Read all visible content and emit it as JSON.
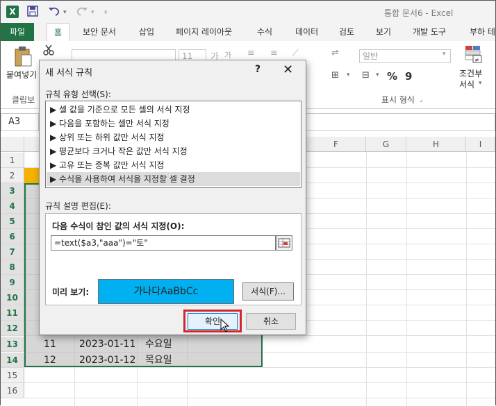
{
  "app": {
    "title": "통합 문서6 - Excel",
    "logo": "X"
  },
  "quick_access": {
    "icons": [
      "save-icon",
      "undo-icon",
      "redo-icon",
      "customize-icon"
    ]
  },
  "tabs": [
    "파일",
    "홈",
    "보안 문서",
    "삽입",
    "페이지 레이아웃",
    "수식",
    "데이터",
    "검토",
    "보기",
    "개발 도구",
    "부하 테"
  ],
  "ribbon": {
    "paste_label": "붙여넣기",
    "clipboard_label": "클립보",
    "font_size": "11",
    "number_format": "일반",
    "percent": "%",
    "comma": "9",
    "number_group_label": "표시 형식",
    "cond_format_line1": "조건부",
    "cond_format_line2": "서식 ",
    "cut_icon": "scissors-icon"
  },
  "namebox": "A3",
  "columns": [
    "F",
    "G",
    "H",
    "I"
  ],
  "rows": [
    "1",
    "2",
    "3",
    "4",
    "5",
    "6",
    "7",
    "8",
    "9",
    "10",
    "11",
    "12",
    "13",
    "14",
    "15",
    "16"
  ],
  "cells": [
    {
      "row": "13",
      "num": "11",
      "date": "2023-01-11",
      "day": "수요일"
    },
    {
      "row": "14",
      "num": "12",
      "date": "2023-01-12",
      "day": "목요일"
    }
  ],
  "dialog": {
    "title": "새 서식 규칙",
    "help": "?",
    "close": "✕",
    "rule_type_label": "규칙 유형 선택(S):",
    "rule_types": [
      "▶ 셀 값을 기준으로 모든 셀의 서식 지정",
      "▶ 다음을 포함하는 셀만 서식 지정",
      "▶ 상위 또는 하위 값만 서식 지정",
      "▶ 평균보다 크거나 작은 값만 서식 지정",
      "▶ 고유 또는 중복 값만 서식 지정",
      "▶ 수식을 사용하여 서식을 지정할 셀 결정"
    ],
    "desc_label": "규칙 설명 편집(E):",
    "formula_label": "다음 수식이 참인 값의 서식 지정(O):",
    "formula_value": "=text($a3,\"aaa\")=\"토\"",
    "preview_label": "미리 보기:",
    "preview_text": "가나다AaBbCc",
    "format_button": "서식(F)...",
    "ok_button": "확인",
    "cancel_button": "취소"
  },
  "colors": {
    "excel_green": "#217346",
    "preview_fill": "#00b0f0",
    "highlight": "#d1262c"
  }
}
